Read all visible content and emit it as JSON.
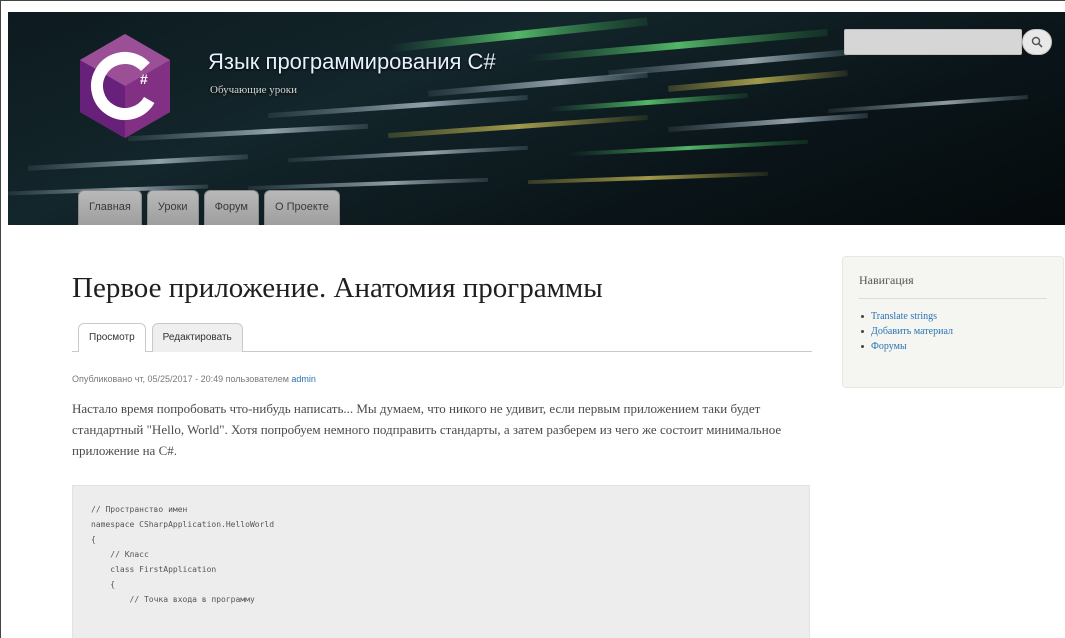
{
  "header": {
    "site_name": "Язык программирования C#",
    "slogan": "Обучающие уроки",
    "logo_text": "C#",
    "colors": {
      "logo_purple": "#68217a",
      "logo_light": "#9b4f96",
      "background": "#0d1a1f"
    }
  },
  "search": {
    "value": "",
    "icon": "search-icon"
  },
  "main_menu": [
    {
      "label": "Главная"
    },
    {
      "label": "Уроки"
    },
    {
      "label": "Форум"
    },
    {
      "label": "О Проекте"
    }
  ],
  "content": {
    "title": "Первое приложение. Анатомия программы",
    "tabs": [
      {
        "label": "Просмотр",
        "active": true
      },
      {
        "label": "Редактировать",
        "active": false
      }
    ],
    "submitted_prefix": "Опубликовано чт, 05/25/2017 - 20:49 пользователем",
    "author": "admin",
    "intro": "Настало время попробовать что-нибудь написать... Мы думаем, что никого не удивит, если первым приложением таки будет стандартный \"Hello, World\". Хотя попробуем немного подправить стандарты, а затем разберем из чего же состоит минимальное приложение на C#.",
    "code": "// Пространство имен\nnamespace CSharpApplication.HelloWorld\n{\n    // Класс\n    class FirstApplication\n    {\n        // Точка входа в программу"
  },
  "sidebar": {
    "title": "Навигация",
    "items": [
      {
        "label": "Translate strings"
      },
      {
        "label": "Добавить материал"
      },
      {
        "label": "Форумы"
      }
    ]
  }
}
